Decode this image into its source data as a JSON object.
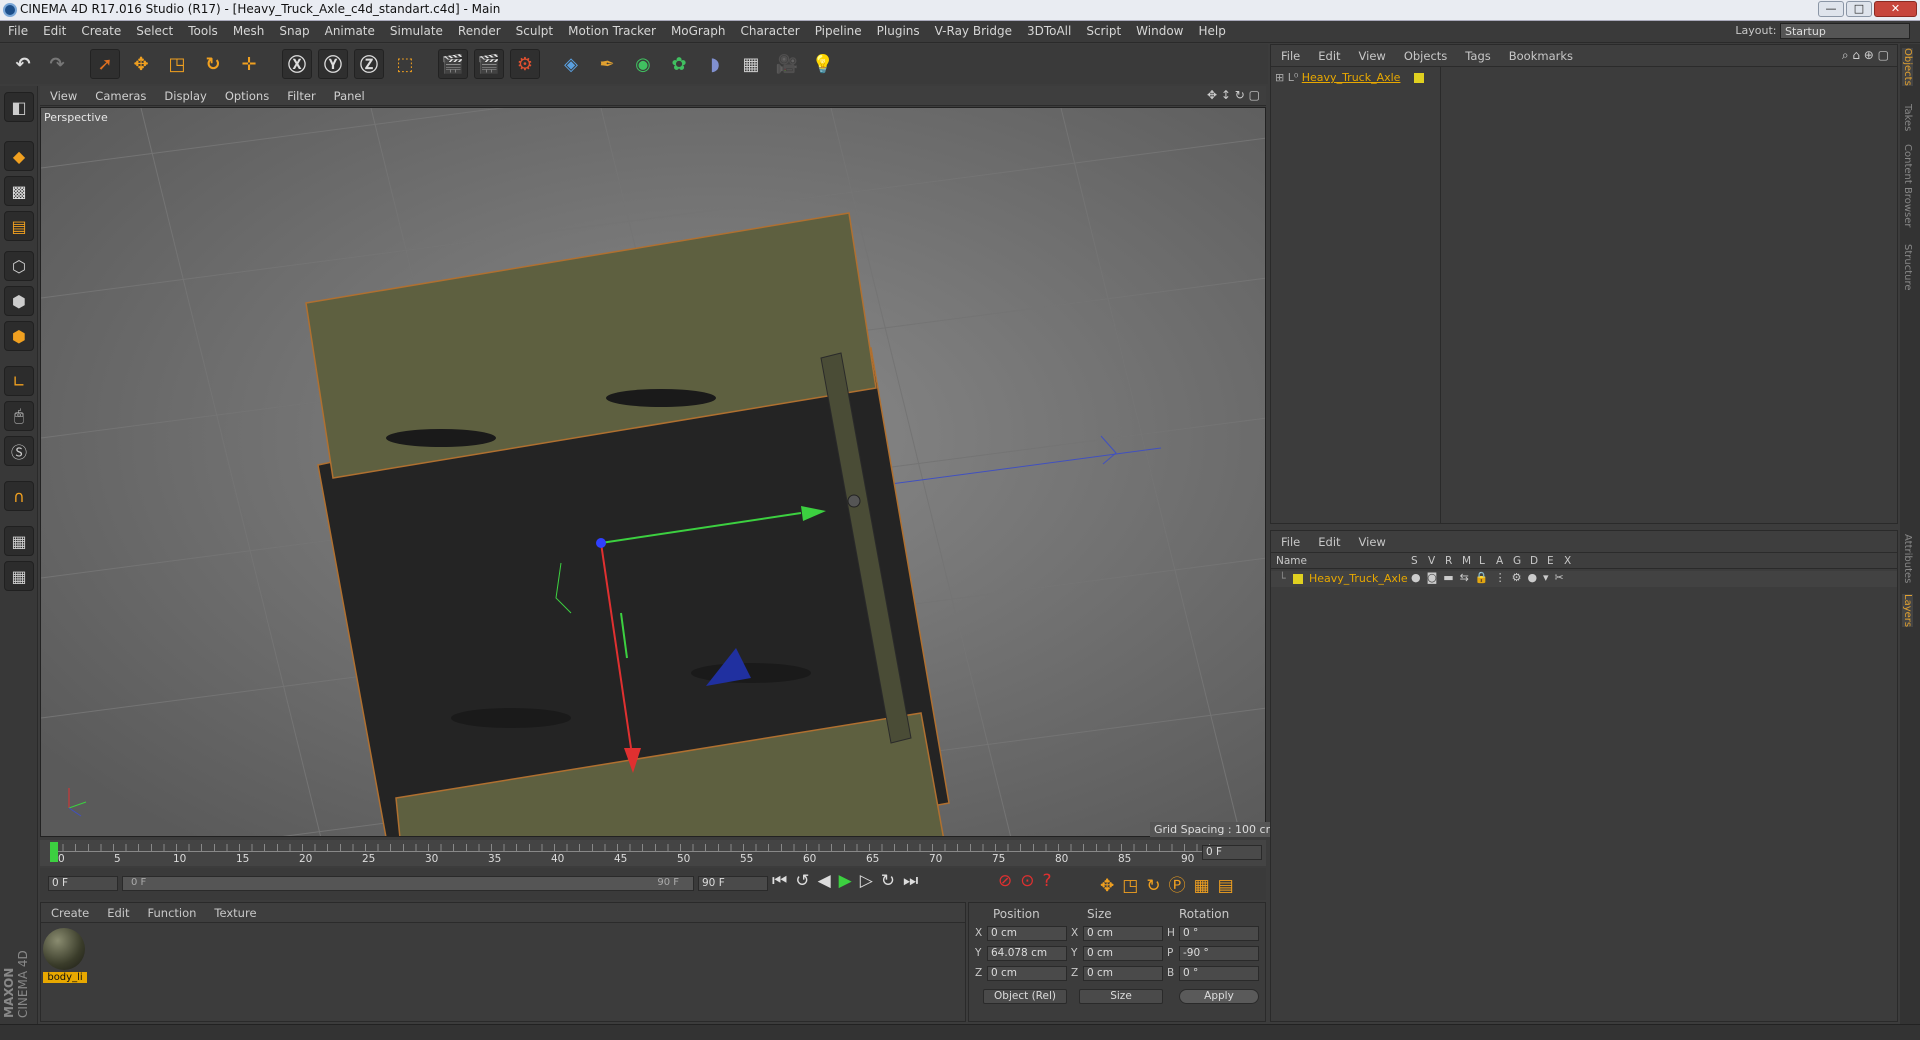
{
  "window": {
    "title": "CINEMA 4D R17.016 Studio (R17) - [Heavy_Truck_Axle_c4d_standart.c4d] - Main",
    "minimize": "—",
    "maximize": "□",
    "close": "✕"
  },
  "menu": [
    "File",
    "Edit",
    "Create",
    "Select",
    "Tools",
    "Mesh",
    "Snap",
    "Animate",
    "Simulate",
    "Render",
    "Sculpt",
    "Motion Tracker",
    "MoGraph",
    "Character",
    "Pipeline",
    "Plugins",
    "V-Ray Bridge",
    "3DToAll",
    "Script",
    "Window",
    "Help"
  ],
  "layout": {
    "label": "Layout:",
    "value": "Startup"
  },
  "viewport": {
    "menu": [
      "View",
      "Cameras",
      "Display",
      "Options",
      "Filter",
      "Panel"
    ],
    "label": "Perspective",
    "grid_spacing": "Grid Spacing : 100 cm"
  },
  "timeline": {
    "ticks": [
      "0",
      "5",
      "10",
      "15",
      "20",
      "25",
      "30",
      "35",
      "40",
      "45",
      "50",
      "55",
      "60",
      "65",
      "70",
      "75",
      "80",
      "85",
      "90"
    ],
    "current_frame": "0 F"
  },
  "playbar": {
    "start": "0 F",
    "range_start": "0 F",
    "range_end": "90 F",
    "end": "90 F"
  },
  "materials": {
    "menu": [
      "Create",
      "Edit",
      "Function",
      "Texture"
    ],
    "items": [
      {
        "name": "body_li"
      }
    ]
  },
  "attributes": {
    "headers": [
      "Position",
      "Size",
      "Rotation"
    ],
    "rows": [
      {
        "axis": "X",
        "pos": "0 cm",
        "saxis": "X",
        "size": "0 cm",
        "raxis": "H",
        "rot": "0 °"
      },
      {
        "axis": "Y",
        "pos": "64.078 cm",
        "saxis": "Y",
        "size": "0 cm",
        "raxis": "P",
        "rot": "-90 °"
      },
      {
        "axis": "Z",
        "pos": "0 cm",
        "saxis": "Z",
        "size": "0 cm",
        "raxis": "B",
        "rot": "0 °"
      }
    ],
    "coord_mode": "Object (Rel)",
    "size_mode": "Size",
    "apply": "Apply"
  },
  "objects": {
    "menu": [
      "File",
      "Edit",
      "View",
      "Objects",
      "Tags",
      "Bookmarks"
    ],
    "items": [
      {
        "name": "Heavy_Truck_Axle"
      }
    ]
  },
  "layers": {
    "menu": [
      "File",
      "Edit",
      "View"
    ],
    "columns": [
      "Name",
      "S",
      "V",
      "R",
      "M",
      "L",
      "A",
      "G",
      "D",
      "E",
      "X"
    ],
    "items": [
      {
        "name": "Heavy_Truck_Axle"
      }
    ]
  },
  "side_tabs": [
    "Objects",
    "Takes",
    "Content Browser",
    "Structure",
    "Attributes",
    "Layers"
  ],
  "brand": {
    "a": "MAXON",
    "b": "CINEMA 4D"
  }
}
